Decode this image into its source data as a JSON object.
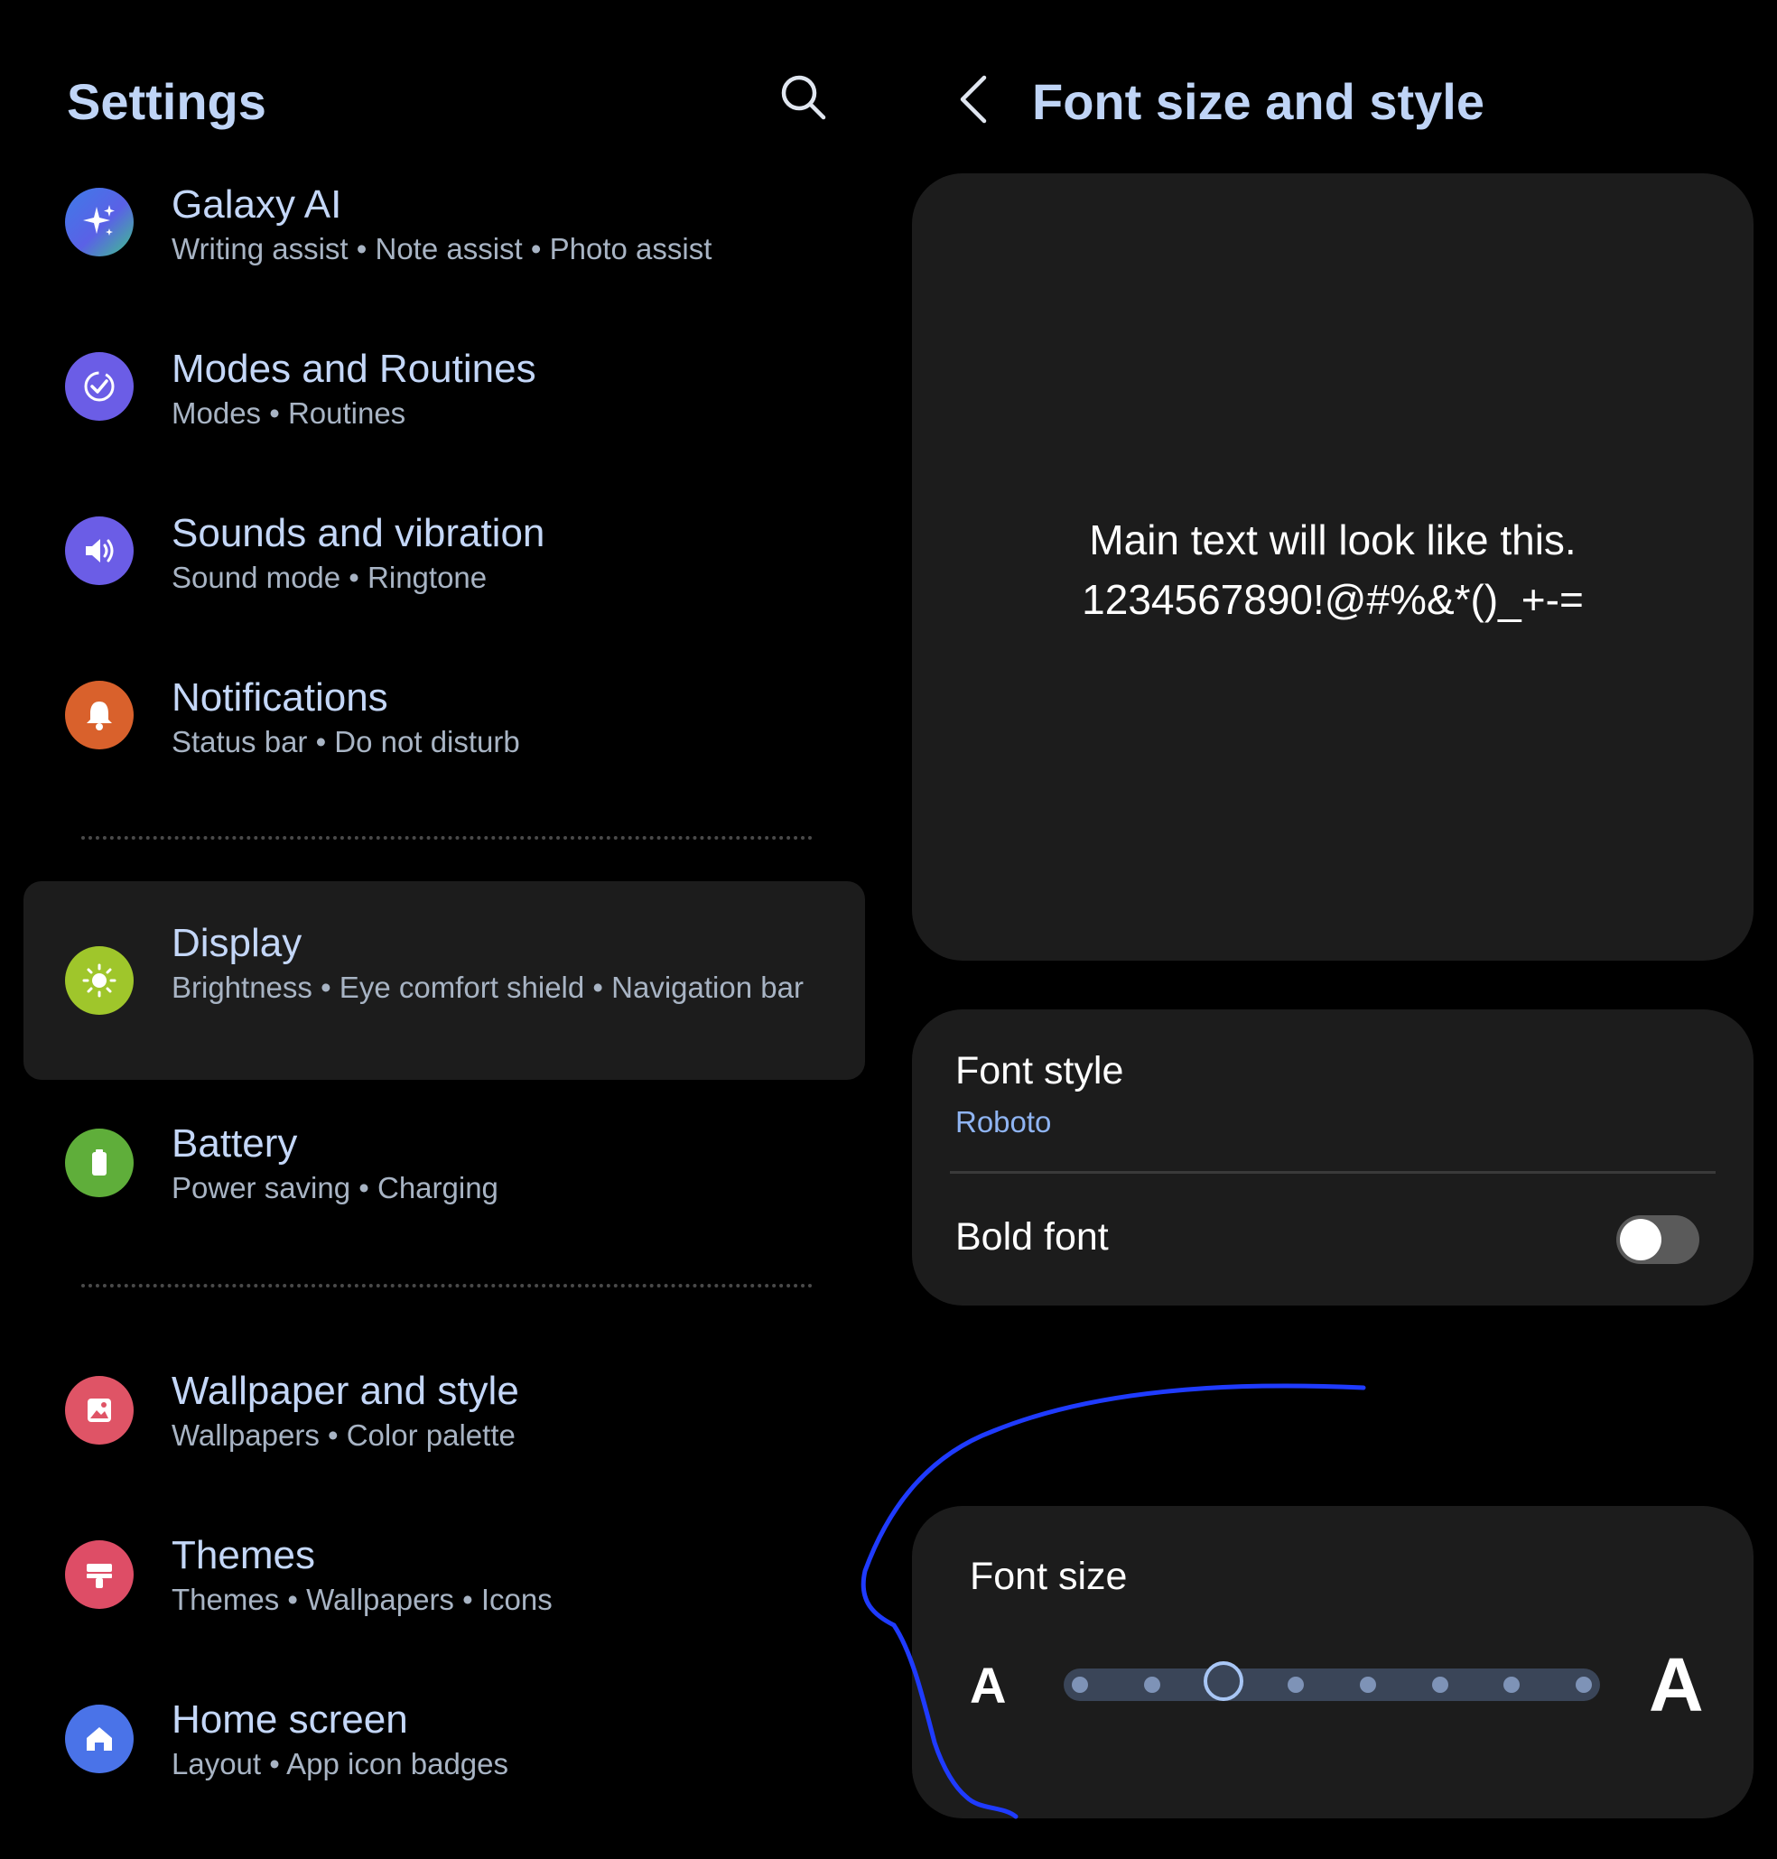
{
  "settings": {
    "title": "Settings",
    "search_icon": "search-icon",
    "items": [
      {
        "id": "galaxy-ai",
        "title": "Galaxy AI",
        "subtitle": "Writing assist  •  Note assist  •  Photo assist",
        "icon": "sparkle-icon",
        "color": "#3f7be8"
      },
      {
        "id": "modes-routines",
        "title": "Modes and Routines",
        "subtitle": "Modes  •  Routines",
        "icon": "check-circle-icon",
        "color": "#6b5de6"
      },
      {
        "id": "sounds-vibration",
        "title": "Sounds and vibration",
        "subtitle": "Sound mode  •  Ringtone",
        "icon": "speaker-icon",
        "color": "#6b5de6"
      },
      {
        "id": "notifications",
        "title": "Notifications",
        "subtitle": "Status bar  •  Do not disturb",
        "icon": "bell-icon",
        "color": "#d9612c"
      },
      {
        "id": "display",
        "title": "Display",
        "subtitle": "Brightness  •  Eye comfort shield  •  Navigation bar",
        "icon": "sun-icon",
        "color": "#9fc62b",
        "selected": true
      },
      {
        "id": "battery",
        "title": "Battery",
        "subtitle": "Power saving  •  Charging",
        "icon": "battery-icon",
        "color": "#5fae3a"
      },
      {
        "id": "wallpaper-style",
        "title": "Wallpaper and style",
        "subtitle": "Wallpapers  •  Color palette",
        "icon": "image-icon",
        "color": "#df5466"
      },
      {
        "id": "themes",
        "title": "Themes",
        "subtitle": "Themes  •  Wallpapers  •  Icons",
        "icon": "brush-icon",
        "color": "#de4d66"
      },
      {
        "id": "home-screen",
        "title": "Home screen",
        "subtitle": "Layout  •  App icon badges",
        "icon": "home-icon",
        "color": "#4a73e8"
      }
    ]
  },
  "font_page": {
    "title": "Font size and style",
    "back_icon": "chevron-left-icon",
    "preview": {
      "line1": "Main text will look like this.",
      "line2": "1234567890!@#%&*()_+-="
    },
    "font_style": {
      "label": "Font style",
      "value": "Roboto"
    },
    "bold_font": {
      "label": "Bold font",
      "enabled": false
    },
    "font_size": {
      "label": "Font size",
      "small_glyph": "A",
      "large_glyph": "A",
      "steps": 8,
      "selected_step": 3
    }
  },
  "annotation": {
    "color": "#1f3bff"
  }
}
